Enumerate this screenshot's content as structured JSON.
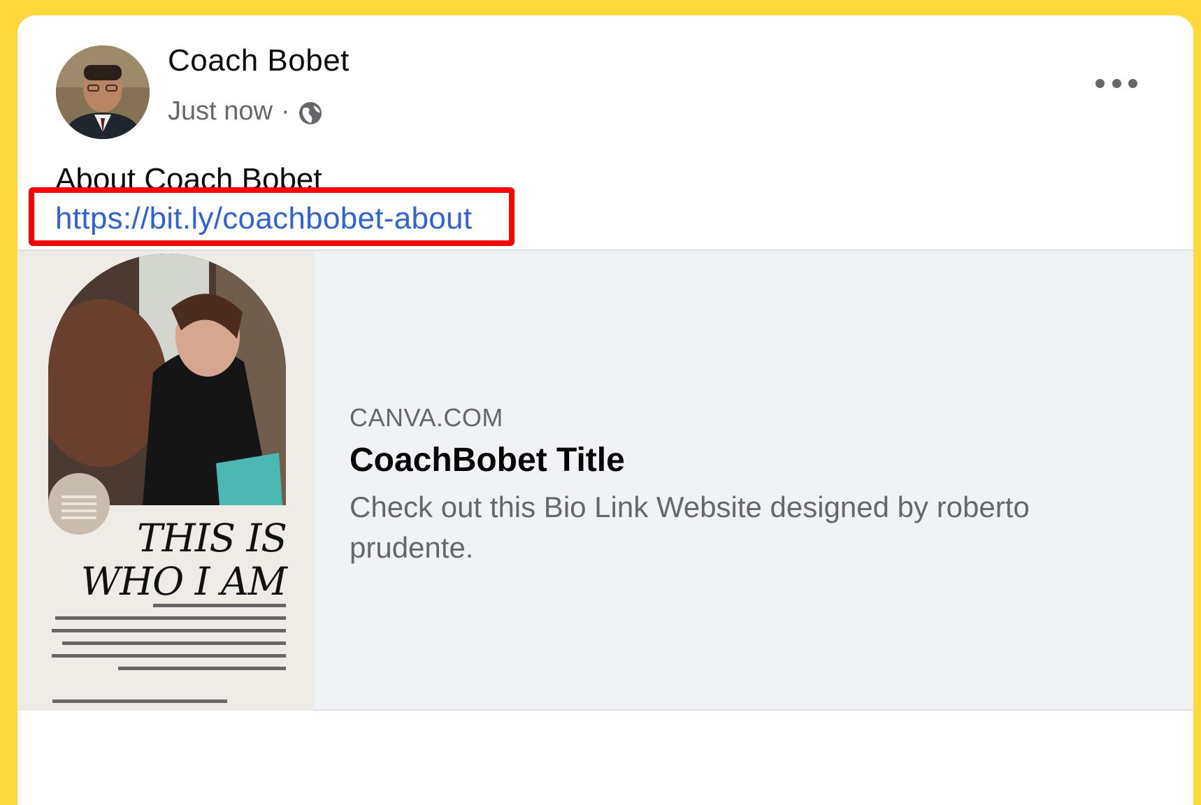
{
  "post": {
    "author": "Coach Bobet",
    "timestamp": "Just now",
    "separator": "·",
    "privacy_icon": "globe-icon",
    "more_icon": "more-options-icon",
    "text": "About Coach Bobet",
    "link": "https://bit.ly/coachbobet-about"
  },
  "preview": {
    "domain": "CANVA.COM",
    "title": "CoachBobet Title",
    "description": "Check out this Bio Link Website designed by roberto prudente.",
    "thumbnail_title": "THIS IS WHO I AM"
  },
  "colors": {
    "background": "#ffd93b",
    "link": "#2e62d8",
    "highlight_box": "#ff0000",
    "secondary_text": "#65676b"
  }
}
